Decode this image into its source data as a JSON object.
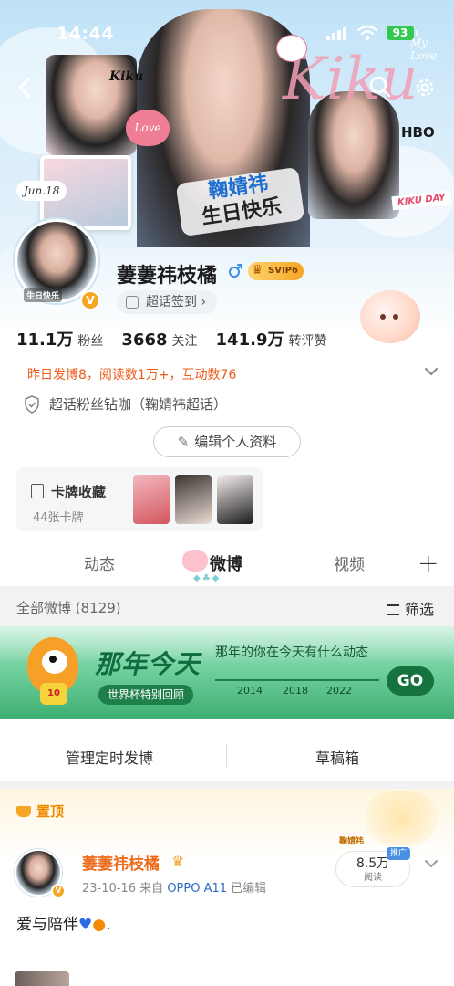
{
  "status_bar": {
    "time": "14:44",
    "battery": "93"
  },
  "banner": {
    "title_line1": "鞠婧祎",
    "title_line2": "生日快乐",
    "date_tag": "Jun.18",
    "kiku_script": "Kiku",
    "kiku_small": "Kiku",
    "love_tag": "Love",
    "hbo": "HBO",
    "kikuday": "KIKU DAY",
    "my_love": "My Love"
  },
  "profile": {
    "username": "萋萋祎枝橘",
    "svip": "SVIP6",
    "checkin": "超话签到",
    "avatar_text": "生日快乐",
    "v_badge": "V",
    "stats": [
      {
        "num": "11.1万",
        "label": "粉丝"
      },
      {
        "num": "3668",
        "label": "关注"
      },
      {
        "num": "141.9万",
        "label": "转评赞"
      }
    ],
    "activity": "昨日发博8，阅读数1万+，互动数76",
    "fanclub": "超话粉丝钻咖（鞠婧祎超话）",
    "edit_button": "编辑个人资料",
    "cards_title": "卡牌收藏",
    "cards_count": "44张卡牌"
  },
  "tabs": [
    {
      "label": "动态",
      "active": false
    },
    {
      "label": "微博",
      "active": true
    },
    {
      "label": "视频",
      "active": false
    }
  ],
  "list": {
    "all_label": "全部微博 (8129)",
    "filter_label": "筛选"
  },
  "promo": {
    "title": "那年今天",
    "subtitle": "那年的你在今天有什么动态",
    "pill": "世界杯特别回顾",
    "years": [
      "2014",
      "2018",
      "2022"
    ],
    "go": "GO",
    "shirt_number": "10"
  },
  "actions": {
    "scheduled": "管理定时发博",
    "drafts": "草稿箱"
  },
  "post": {
    "pinned_label": "置顶",
    "name": "萋萋祎枝橘",
    "date": "23-10-16",
    "source_prefix": "来自",
    "source": "OPPO A11",
    "edited": "已编辑",
    "reads_num": "8.5万",
    "reads_label": "阅读",
    "promo_tag": "推广",
    "side_tag": "鞠婧祎",
    "text": "爱与陪伴",
    "text_suffix": "."
  },
  "colors": {
    "accent_orange": "#ec5b1a",
    "link_blue": "#2b6cc4",
    "svip_gold": "#f5a623",
    "promo_green": "#16733e"
  }
}
